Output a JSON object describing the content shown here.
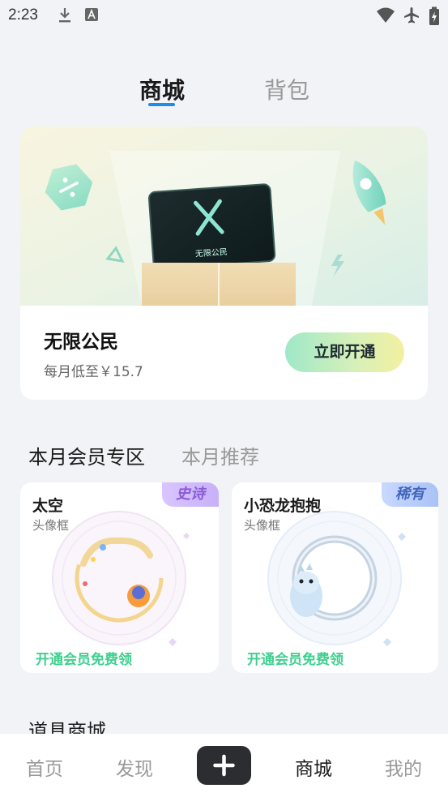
{
  "status_bar": {
    "time": "2:23"
  },
  "top_tabs": [
    {
      "label": "商城",
      "active": true
    },
    {
      "label": "背包",
      "active": false
    }
  ],
  "vip_card": {
    "card_label": "无限公民",
    "title": "无限公民",
    "price": "每月低至￥15.7",
    "button_label": "立即开通"
  },
  "section_tabs": [
    {
      "label": "本月会员专区",
      "active": true
    },
    {
      "label": "本月推荐",
      "active": false
    }
  ],
  "items": [
    {
      "name": "太空",
      "type": "头像框",
      "rarity": "史诗",
      "rarity_color": "#8b5bd8",
      "action": "开通会员免费领"
    },
    {
      "name": "小恐龙抱抱",
      "type": "头像框",
      "rarity": "稀有",
      "rarity_color": "#4466bb",
      "action": "开通会员免费领"
    }
  ],
  "next_section_title": "道具商城",
  "bottom_nav": [
    {
      "label": "首页",
      "active": false
    },
    {
      "label": "发现",
      "active": false
    },
    {
      "label": "商城",
      "active": true
    },
    {
      "label": "我的",
      "active": false
    }
  ],
  "colors": {
    "accent": "#1f8bea",
    "free_green": "#3fcf8f",
    "nav_plus_bg": "#2b2d30"
  }
}
